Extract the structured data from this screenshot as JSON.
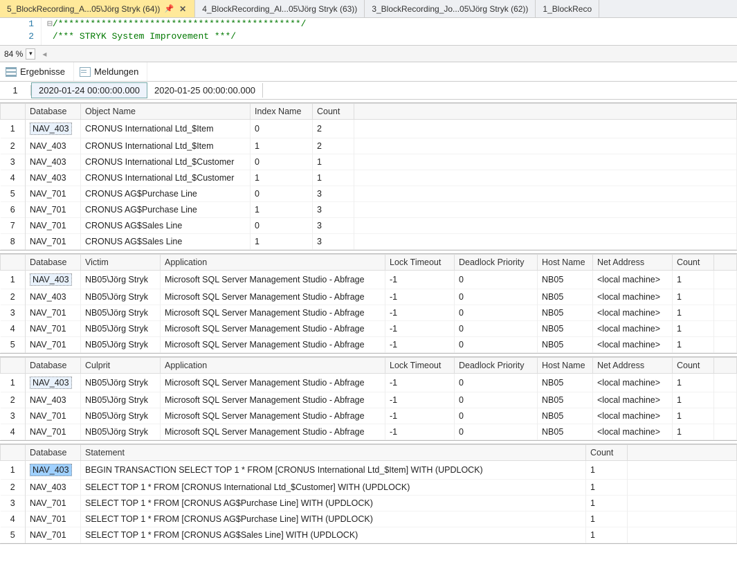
{
  "tabs": [
    {
      "label": "5_BlockRecording_A...05\\Jörg Stryk (64))",
      "active": true,
      "pin": true,
      "close": true
    },
    {
      "label": "4_BlockRecording_Al...05\\Jörg Stryk (63))",
      "active": false
    },
    {
      "label": "3_BlockRecording_Jo...05\\Jörg Stryk (62))",
      "active": false
    },
    {
      "label": "1_BlockReco",
      "active": false
    }
  ],
  "editor": {
    "lines": [
      "1",
      "2"
    ],
    "code": [
      "/*********************************************/",
      "/***         STRYK System Improvement         ***/"
    ]
  },
  "zoom": "84 %",
  "result_tabs": {
    "results": "Ergebnisse",
    "messages": "Meldungen"
  },
  "dates": {
    "rownum": "1",
    "d1": "2020-01-24 00:00:00.000",
    "d2": "2020-01-25 00:00:00.000"
  },
  "grid1": {
    "cols": [
      "Database",
      "Object Name",
      "Index Name",
      "Count"
    ],
    "widths": [
      80,
      245,
      90,
      60
    ],
    "rows": [
      [
        "NAV_403",
        "CRONUS International Ltd_$Item",
        "0",
        "2"
      ],
      [
        "NAV_403",
        "CRONUS International Ltd_$Item",
        "1",
        "2"
      ],
      [
        "NAV_403",
        "CRONUS International Ltd_$Customer",
        "0",
        "1"
      ],
      [
        "NAV_403",
        "CRONUS International Ltd_$Customer",
        "1",
        "1"
      ],
      [
        "NAV_701",
        "CRONUS AG$Purchase Line",
        "0",
        "3"
      ],
      [
        "NAV_701",
        "CRONUS AG$Purchase Line",
        "1",
        "3"
      ],
      [
        "NAV_701",
        "CRONUS AG$Sales Line",
        "0",
        "3"
      ],
      [
        "NAV_701",
        "CRONUS AG$Sales Line",
        "1",
        "3"
      ]
    ]
  },
  "grid2": {
    "cols": [
      "Database",
      "Victim",
      "Application",
      "Lock Timeout",
      "Deadlock Priority",
      "Host Name",
      "Net Address",
      "Count"
    ],
    "widths": [
      80,
      115,
      325,
      100,
      120,
      80,
      115,
      60
    ],
    "rows": [
      [
        "NAV_403",
        "NB05\\Jörg Stryk",
        "Microsoft SQL Server Management Studio - Abfrage",
        "-1",
        "0",
        "NB05",
        "<local machine>",
        "1"
      ],
      [
        "NAV_403",
        "NB05\\Jörg Stryk",
        "Microsoft SQL Server Management Studio - Abfrage",
        "-1",
        "0",
        "NB05",
        "<local machine>",
        "1"
      ],
      [
        "NAV_701",
        "NB05\\Jörg Stryk",
        "Microsoft SQL Server Management Studio - Abfrage",
        "-1",
        "0",
        "NB05",
        "<local machine>",
        "1"
      ],
      [
        "NAV_701",
        "NB05\\Jörg Stryk",
        "Microsoft SQL Server Management Studio - Abfrage",
        "-1",
        "0",
        "NB05",
        "<local machine>",
        "1"
      ],
      [
        "NAV_701",
        "NB05\\Jörg Stryk",
        "Microsoft SQL Server Management Studio - Abfrage",
        "-1",
        "0",
        "NB05",
        "<local machine>",
        "1"
      ]
    ]
  },
  "grid3": {
    "cols": [
      "Database",
      "Culprit",
      "Application",
      "Lock Timeout",
      "Deadlock Priority",
      "Host Name",
      "Net Address",
      "Count"
    ],
    "widths": [
      80,
      115,
      325,
      100,
      120,
      80,
      115,
      60
    ],
    "rows": [
      [
        "NAV_403",
        "NB05\\Jörg Stryk",
        "Microsoft SQL Server Management Studio - Abfrage",
        "-1",
        "0",
        "NB05",
        "<local machine>",
        "1"
      ],
      [
        "NAV_403",
        "NB05\\Jörg Stryk",
        "Microsoft SQL Server Management Studio - Abfrage",
        "-1",
        "0",
        "NB05",
        "<local machine>",
        "1"
      ],
      [
        "NAV_701",
        "NB05\\Jörg Stryk",
        "Microsoft SQL Server Management Studio - Abfrage",
        "-1",
        "0",
        "NB05",
        "<local machine>",
        "1"
      ],
      [
        "NAV_701",
        "NB05\\Jörg Stryk",
        "Microsoft SQL Server Management Studio - Abfrage",
        "-1",
        "0",
        "NB05",
        "<local machine>",
        "1"
      ]
    ]
  },
  "grid4": {
    "cols": [
      "Database",
      "Statement",
      "Count"
    ],
    "widths": [
      80,
      730,
      60
    ],
    "rows": [
      [
        "NAV_403",
        "BEGIN TRANSACTION   SELECT TOP 1 * FROM [CRONUS International Ltd_$Item] WITH (UPDLOCK)",
        "1"
      ],
      [
        "NAV_403",
        "SELECT TOP 1 * FROM [CRONUS International Ltd_$Customer] WITH (UPDLOCK)",
        "1"
      ],
      [
        "NAV_701",
        "SELECT TOP 1 * FROM [CRONUS AG$Purchase Line] WITH (UPDLOCK)",
        "1"
      ],
      [
        "NAV_701",
        "SELECT TOP 1 * FROM [CRONUS AG$Purchase Line] WITH (UPDLOCK)",
        "1"
      ],
      [
        "NAV_701",
        "SELECT TOP 1 * FROM [CRONUS AG$Sales Line] WITH (UPDLOCK)",
        "1"
      ]
    ]
  }
}
